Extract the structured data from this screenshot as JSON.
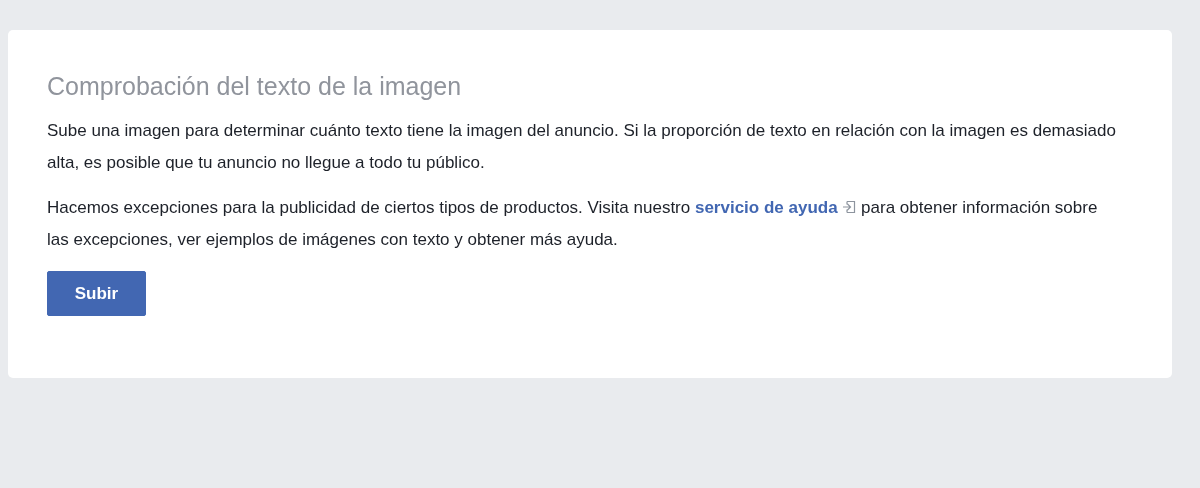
{
  "card": {
    "title": "Comprobación del texto de la imagen",
    "intro": "Sube una imagen para determinar cuánto texto tiene la imagen del anuncio. Si la proporción de texto en relación con la imagen es demasiado alta, es posible que tu anuncio no llegue a todo tu público.",
    "note": {
      "before": "Hacemos excepciones para la publicidad de ciertos tipos de productos. Visita nuestro",
      "link": "servicio de ayuda",
      "after": "para obtener información sobre las excepciones, ver ejemplos de imágenes con texto y obtener más ayuda."
    },
    "button": "Subir"
  }
}
